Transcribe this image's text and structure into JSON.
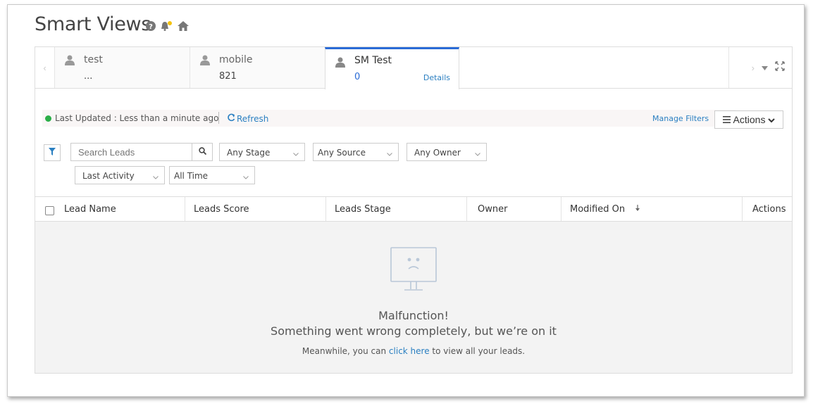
{
  "header": {
    "title": "Smart Views"
  },
  "tabs": [
    {
      "name": "test",
      "count": "..."
    },
    {
      "name": "mobile",
      "count": "821"
    },
    {
      "name": "SM Test",
      "count": "0",
      "details": "Details"
    }
  ],
  "status": {
    "last_updated": "Last Updated : Less than a minute ago",
    "refresh": "Refresh",
    "manage_filters": "Manage Filters",
    "actions": "Actions"
  },
  "filters": {
    "search_placeholder": "Search Leads",
    "stage": "Any Stage",
    "source": "Any Source",
    "owner": "Any Owner",
    "activity": "Last Activity",
    "time": "All Time"
  },
  "grid": {
    "columns": [
      "Lead Name",
      "Leads Score",
      "Leads Stage",
      "Owner",
      "Modified On",
      "Actions"
    ]
  },
  "empty": {
    "title": "Malfunction!",
    "subtitle": "Something went wrong completely, but we’re on it",
    "line_prefix": "Meanwhile, you can",
    "link": "click here",
    "line_suffix": "to view all your leads."
  },
  "colors": {
    "accent": "#2a6bd6",
    "link": "#2a7fc1",
    "status_green": "#2bae48"
  }
}
